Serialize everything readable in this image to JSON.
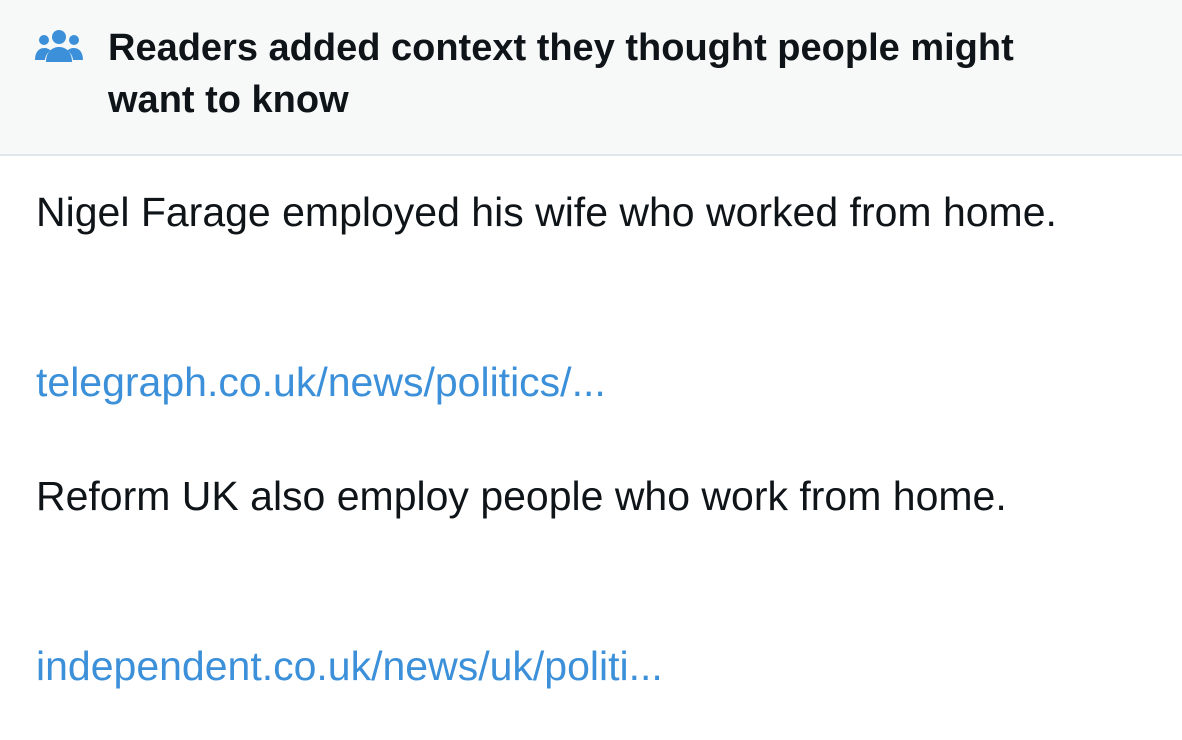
{
  "header": {
    "icon": "people-group-icon",
    "title": "Readers added context they thought people might want to know",
    "icon_color": "#3b90d9",
    "background": "#f7f9f9"
  },
  "body": {
    "paragraph_1": "Nigel Farage employed his wife who worked from home.",
    "link_1": "telegraph.co.uk/news/politics/...",
    "paragraph_2": "Reform UK also employ people who work from home.",
    "link_2": "independent.co.uk/news/uk/politi...",
    "link_color": "#3b90d9",
    "text_color": "#0f1419"
  }
}
